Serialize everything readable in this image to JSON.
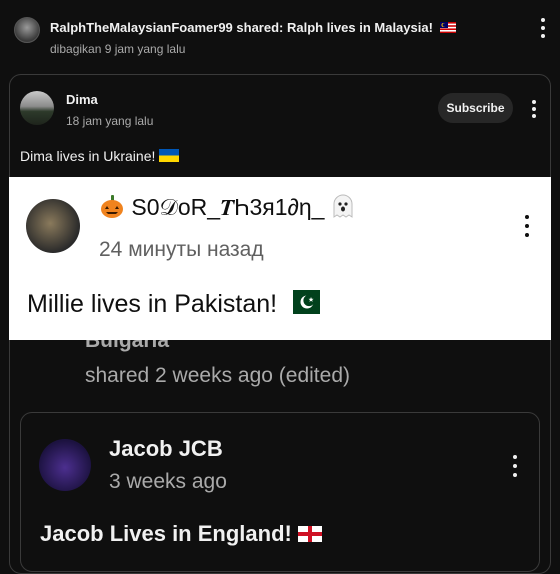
{
  "share_header": {
    "title": "RalphTheMalaysianFoamer99 shared: Ralph lives in Malaysia!",
    "subtitle": "dibagikan 9 jam yang lalu",
    "flag_icon": "malaysia-flag-icon"
  },
  "post_dima": {
    "author": "Dima",
    "time": "18 jam yang lalu",
    "subscribe_label": "Subscribe",
    "text": "Dima lives in Ukraine!",
    "flag_icon": "ukraine-flag-icon"
  },
  "post_sodor": {
    "pumpkin_icon": "pumpkin-icon",
    "author": "S0𝒟oR_𝑻Һ3я1∂η_",
    "ghost_icon": "ghost-icon",
    "time": "24 минуты назад",
    "text": "Millie lives in Pakistan!",
    "flag_icon": "pakistan-flag-icon"
  },
  "post_bulgaria": {
    "author_partial": "Bulgaria",
    "time": "shared 2 weeks ago (edited)"
  },
  "post_jacob": {
    "author": "Jacob JCB",
    "time": "3 weeks ago",
    "text": "Jacob Lives in England!",
    "flag_icon": "england-flag-icon"
  },
  "colors": {
    "background": "#0f0f0f",
    "card_border": "#3a3a3a",
    "secondary_text": "#aaaaaa",
    "subscribe_bg": "#272727",
    "white_panel": "#ffffff"
  }
}
